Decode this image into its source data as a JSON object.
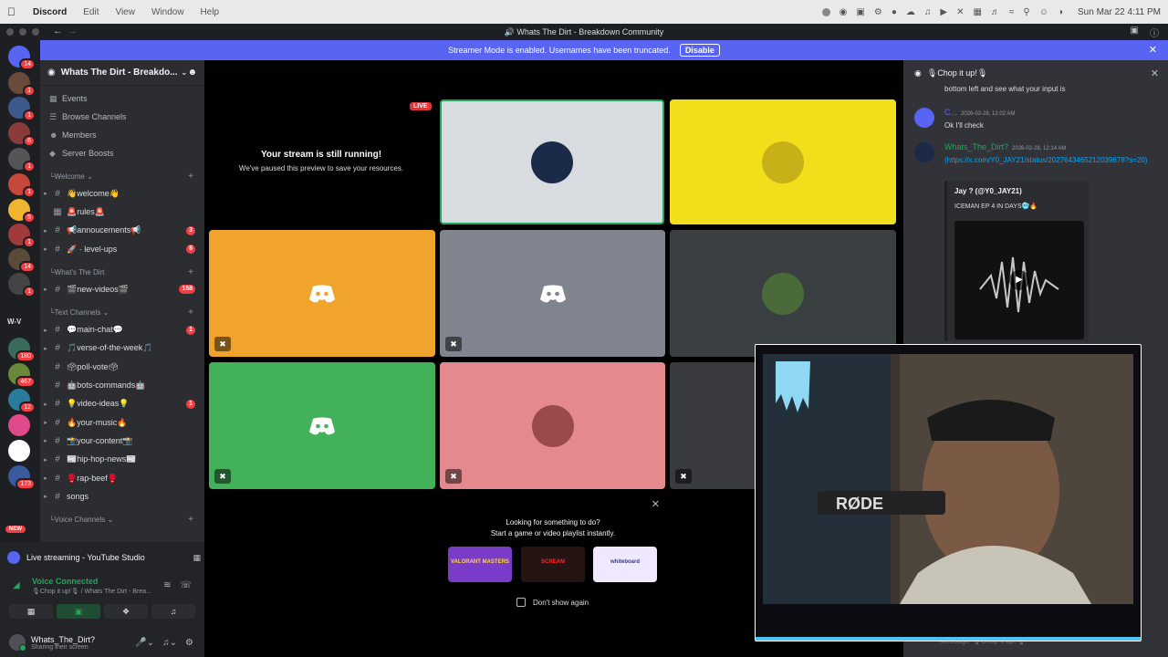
{
  "menubar": {
    "app": "Discord",
    "items": [
      "Edit",
      "View",
      "Window",
      "Help"
    ],
    "clock": "Sun Mar 22  4:11 PM"
  },
  "titlebar": {
    "title": "Whats The Dirt - Breakdown Community"
  },
  "banner": {
    "text": "Streamer Mode is enabled. Usernames have been truncated.",
    "button": "Disable"
  },
  "servers": {
    "badges": [
      "14",
      "1",
      "1",
      "6",
      "1",
      "1",
      "5",
      "1",
      "14",
      "1",
      "180",
      "467",
      "12",
      "173"
    ],
    "text_icon": "W-V",
    "new_label": "NEW"
  },
  "sidebar": {
    "guild_name": "Whats The Dirt - Breakdo...",
    "nav": [
      {
        "label": "Events",
        "icon": "calendar-icon"
      },
      {
        "label": "Browse Channels",
        "icon": "browse-icon"
      },
      {
        "label": "Members",
        "icon": "members-icon"
      },
      {
        "label": "Server Boosts",
        "icon": "boost-icon"
      }
    ],
    "categories": {
      "welcome": "Welcome",
      "whats_the_dirt": "What's The Dirt",
      "text_channels": "Text Channels",
      "voice_channels": "Voice Channels"
    },
    "channels": [
      {
        "name": "👋welcome👋",
        "count": ""
      },
      {
        "name": "🚨rules🚨",
        "count": ""
      },
      {
        "name": "📢annoucements📢",
        "count": "3"
      },
      {
        "name": "🚀 · level-ups",
        "count": "8"
      },
      {
        "name": "🎬new-videos🎬",
        "count": "158"
      },
      {
        "name": "💬main-chat💬",
        "count": "1"
      },
      {
        "name": "🎵verse-of-the-week🎵",
        "count": ""
      },
      {
        "name": "🗳poll-vote🗳",
        "count": ""
      },
      {
        "name": "🤖bots-commands🤖",
        "count": ""
      },
      {
        "name": "💡video-ideas💡",
        "count": "1"
      },
      {
        "name": "🔥your-music🔥",
        "count": ""
      },
      {
        "name": "📸your-content📸",
        "count": ""
      },
      {
        "name": "📰hip-hop-news📰",
        "count": ""
      },
      {
        "name": "🥊rap-beef🥊",
        "count": ""
      },
      {
        "name": "songs",
        "count": ""
      }
    ]
  },
  "panel": {
    "live_label": "Live streaming - YouTube Studio",
    "voice_status": "Voice Connected",
    "voice_channel": "🎙Chop it up!🎙 / Whats The Dirt - Brea...",
    "username": "Whats_The_Dirt?",
    "user_status": "Sharing their screen"
  },
  "stage": {
    "stream_title": "Your stream is still running!",
    "stream_sub": "We've paused this preview to save your resources.",
    "live_badge": "LIVE",
    "tile_colors": {
      "yellow": "#f0df1a",
      "orange": "#f0a42c",
      "gray": "#80848e",
      "dark": "#3a4042",
      "green": "#43b15a",
      "pink": "#e48a8e",
      "stream": "#d8dbe0"
    }
  },
  "activity": {
    "line1": "Looking for something to do?",
    "line2": "Start a game or video playlist instantly.",
    "cards": [
      {
        "label": "VALORANT MASTERS",
        "bg": "#7a3bc9"
      },
      {
        "label": "SCREAM",
        "bg": "#241412"
      },
      {
        "label": "whiteboard",
        "bg": "#efe8ff"
      }
    ],
    "checkbox": "Don't show again"
  },
  "thread": {
    "title": "🎙Chop it up!🎙",
    "fragment": "bottom left and see what your input is",
    "messages": [
      {
        "name": "C...",
        "time": "2026-02-28, 12:02 AM",
        "text": "Ok I'll check"
      },
      {
        "name": "Whats_The_Dirt?",
        "time": "2026-02-28, 12:14 AM",
        "link": "(https://x.com/Y0_JAY21/status/2027643465212039678?s=20)"
      }
    ],
    "embed": {
      "author": "Jay ? (@Y0_JAY21)",
      "text": "ICEMAN EP 4 IN DAYS🥶🔥"
    },
    "input_placeholder": "Message 🎙Chop it up!🎙"
  }
}
